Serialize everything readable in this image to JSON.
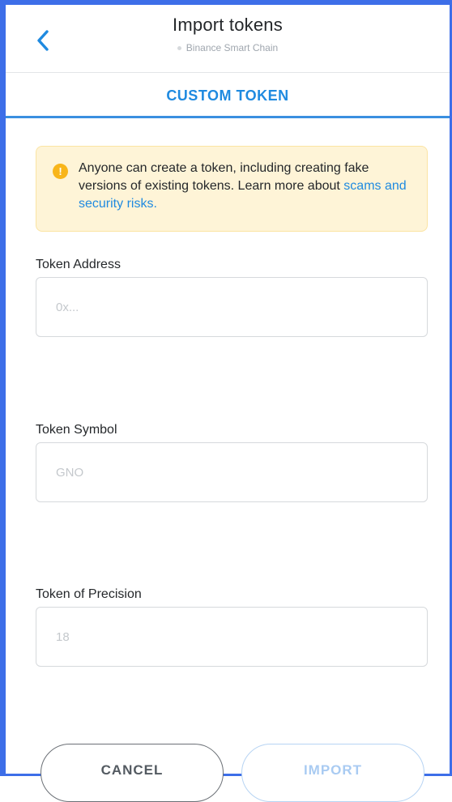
{
  "header": {
    "title": "Import tokens",
    "network": "Binance Smart Chain"
  },
  "tab": {
    "label": "CUSTOM TOKEN"
  },
  "warning": {
    "text": "Anyone can create a token, including creating fake versions of existing tokens. Learn more about",
    "link": "scams and security risks."
  },
  "form": {
    "address": {
      "label": "Token Address",
      "placeholder": "0x...",
      "value": ""
    },
    "symbol": {
      "label": "Token Symbol",
      "placeholder": "GNO",
      "value": ""
    },
    "precision": {
      "label": "Token of Precision",
      "placeholder": "18",
      "value": ""
    }
  },
  "buttons": {
    "cancel": "CANCEL",
    "import": "IMPORT"
  },
  "colors": {
    "frame": "#3d6ee8",
    "accent": "#1f8ae0",
    "warning_bg": "#fef4d7",
    "warning_icon": "#f8b51a"
  },
  "icons": {
    "back": "chevron-left-icon",
    "warning": "exclamation-circle-icon",
    "network": "network-dot-icon"
  }
}
